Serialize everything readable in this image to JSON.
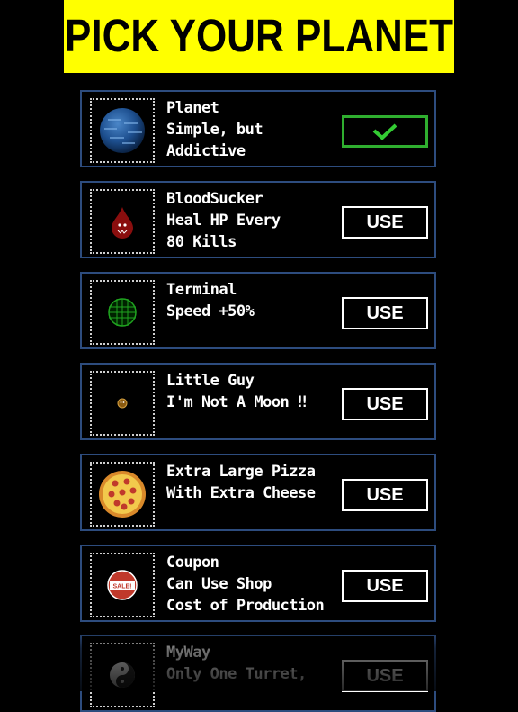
{
  "header": {
    "title": "PICK YOUR PLANET"
  },
  "colors": {
    "header_bg": "#ffff00",
    "card_border": "#2d4c7e",
    "selected_border": "#2fae2f",
    "check": "#33cc33"
  },
  "planets": [
    {
      "name": "Planet",
      "desc1": "Simple, but",
      "desc2": "Addictive",
      "button": "",
      "selected": true,
      "icon": "blue-planet-icon"
    },
    {
      "name": "BloodSucker",
      "desc1": "Heal HP Every",
      "desc2": "80 Kills",
      "button": "USE",
      "selected": false,
      "icon": "blood-drop-icon"
    },
    {
      "name": "Terminal",
      "desc1": "Speed +50%",
      "desc2": "",
      "button": "USE",
      "selected": false,
      "icon": "green-grid-globe-icon"
    },
    {
      "name": "Little Guy",
      "desc1": "I'm Not A Moon ‼",
      "desc2": "",
      "button": "USE",
      "selected": false,
      "icon": "tiny-planet-icon"
    },
    {
      "name": "Extra Large Pizza",
      "desc1": "With Extra Cheese",
      "desc2": "",
      "button": "USE",
      "selected": false,
      "icon": "pizza-icon"
    },
    {
      "name": "Coupon",
      "desc1": "Can Use Shop",
      "desc2": "Cost of Production",
      "button": "USE",
      "selected": false,
      "icon": "sale-sign-icon"
    },
    {
      "name": "MyWay",
      "desc1": "Only One Turret,",
      "desc2": "",
      "button": "USE",
      "selected": false,
      "icon": "yin-yang-icon"
    }
  ]
}
